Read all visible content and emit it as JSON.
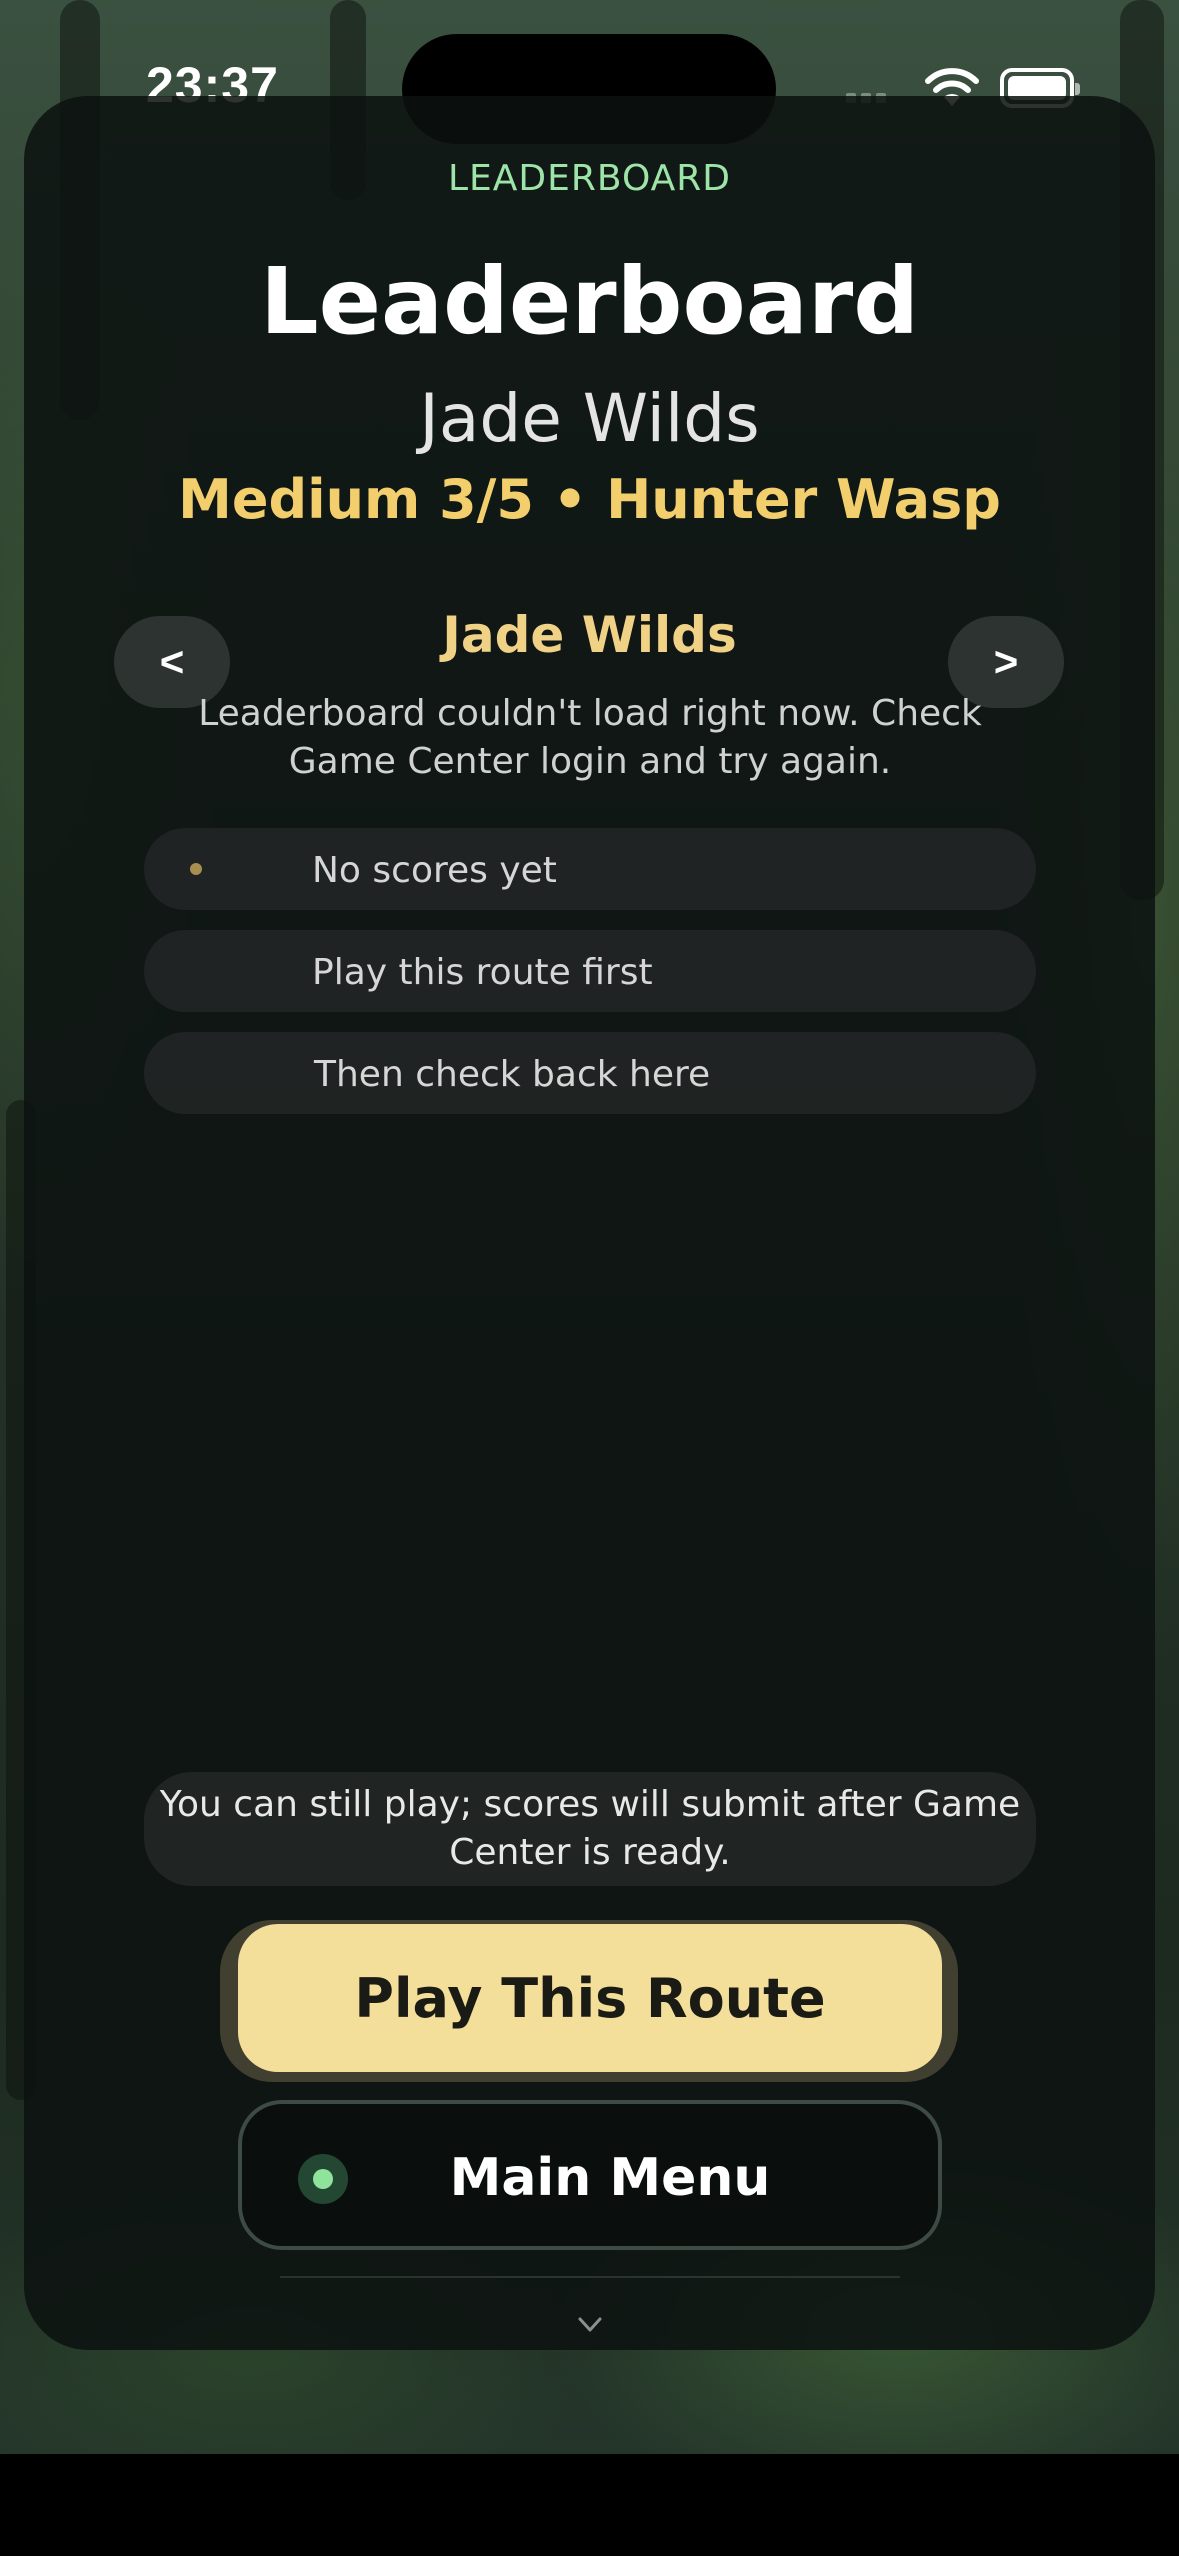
{
  "status_bar": {
    "time": "23:37"
  },
  "header": {
    "eyebrow": "LEADERBOARD",
    "title": "Leaderboard",
    "route": "Jade Wilds",
    "meta": "Medium 3/5 • Hunter Wasp"
  },
  "selector": {
    "prev_label": "<",
    "next_label": ">",
    "route_name": "Jade Wilds",
    "error": "Leaderboard couldn't load right now. Check Game Center login and try again."
  },
  "entries": [
    {
      "text": "No scores yet"
    },
    {
      "text": "Play this route first"
    },
    {
      "text": "Then check back here"
    }
  ],
  "notice": "You can still play; scores will submit after Game Center is ready.",
  "actions": {
    "play_label": "Play This Route",
    "menu_label": "Main Menu"
  },
  "colors": {
    "accent_green": "#9ee4a8",
    "accent_gold": "#f2cf6c",
    "play_button": "#f3de9a"
  },
  "icons": [
    "signal-icon",
    "wifi-icon",
    "battery-icon",
    "chevron-down-icon",
    "status-dot-icon"
  ]
}
